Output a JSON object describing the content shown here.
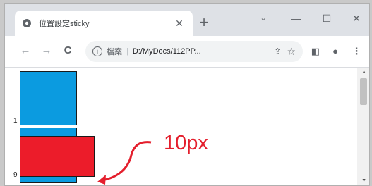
{
  "browser": {
    "tab": {
      "title": "位置設定sticky"
    },
    "new_tab_label": "+",
    "controls": {
      "tab_search": "⌄",
      "minimize": "—",
      "maximize": "☐",
      "close": "✕",
      "tab_close": "✕"
    },
    "nav": {
      "back": "←",
      "forward": "→",
      "reload": "C"
    },
    "omnibox": {
      "info_glyph": "i",
      "label": "檔案",
      "separator": "|",
      "url": "D:/MyDocs/112PP..."
    },
    "toolbar_icons": {
      "share": "⇪",
      "star": "☆",
      "side_panel": "◧",
      "profile": "●",
      "menu": "⋮"
    }
  },
  "page": {
    "numbers": {
      "first": "1",
      "second": "9"
    }
  },
  "annotation": {
    "text": "10px",
    "color": "#e41f2d"
  },
  "colors": {
    "blue_box": "#0b9be0",
    "red_box": "#ec1c2a"
  }
}
